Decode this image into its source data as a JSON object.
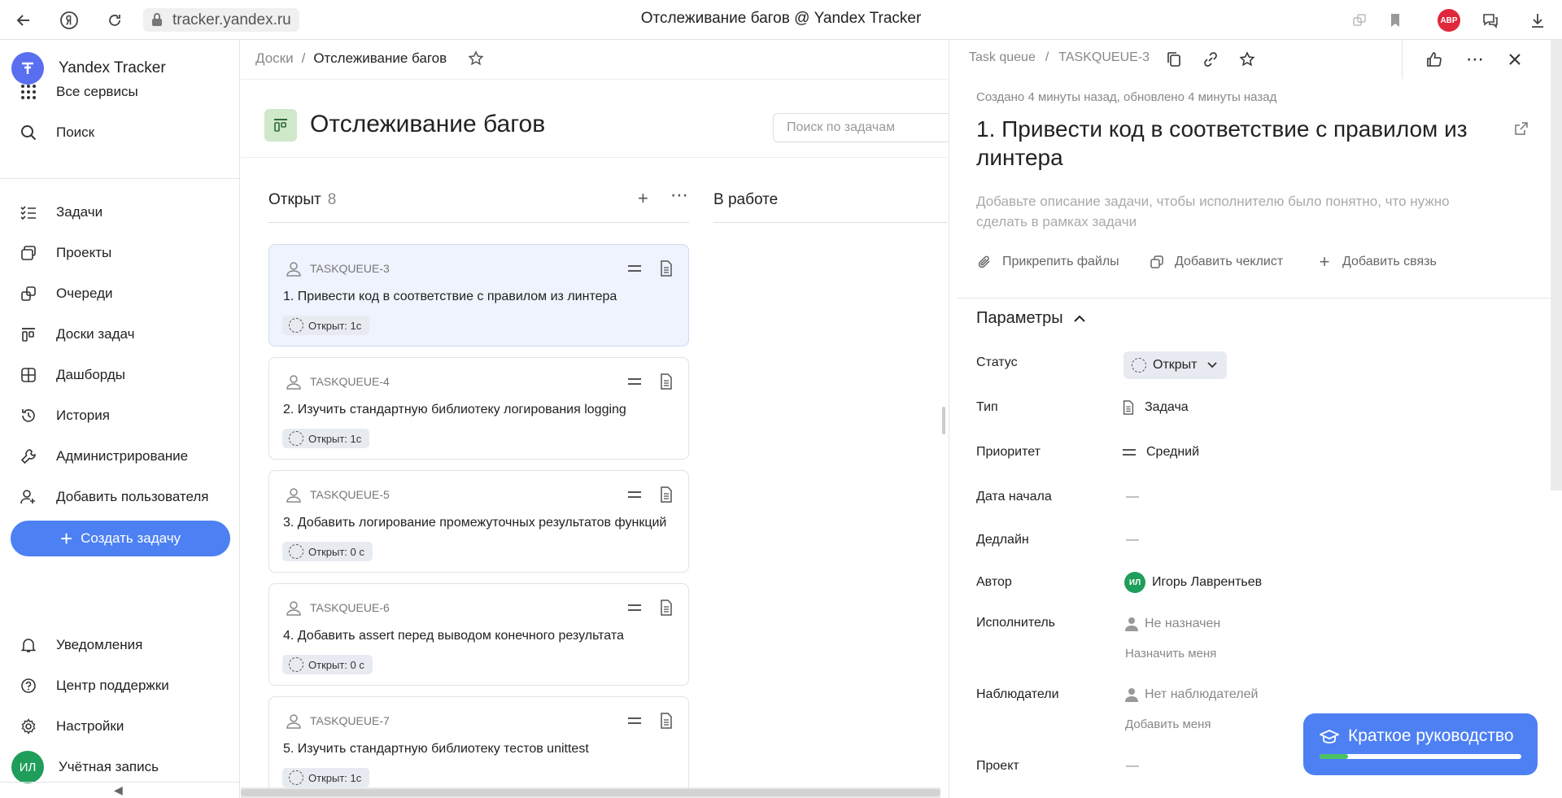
{
  "browser": {
    "url": "tracker.yandex.ru",
    "window_title": "Отслеживание багов @ Yandex Tracker",
    "abp_label": "ABP"
  },
  "sidebar": {
    "app_name": "Yandex Tracker",
    "all_services": "Все сервисы",
    "search": "Поиск",
    "items": [
      {
        "label": "Задачи",
        "icon": "tasks-icon"
      },
      {
        "label": "Проекты",
        "icon": "projects-icon"
      },
      {
        "label": "Очереди",
        "icon": "queues-icon"
      },
      {
        "label": "Доски задач",
        "icon": "boards-icon"
      },
      {
        "label": "Дашборды",
        "icon": "dashboards-icon"
      },
      {
        "label": "История",
        "icon": "history-icon"
      },
      {
        "label": "Администрирование",
        "icon": "admin-icon"
      },
      {
        "label": "Добавить пользователя",
        "icon": "add-user-icon"
      }
    ],
    "create_task": "Создать задачу",
    "bottom": {
      "notifications": "Уведомления",
      "support": "Центр поддержки",
      "settings": "Настройки",
      "account": "Учётная запись",
      "account_initials": "ИЛ"
    }
  },
  "board": {
    "breadcrumb_root": "Доски",
    "breadcrumb_current": "Отслеживание багов",
    "title": "Отслеживание багов",
    "search_placeholder": "Поиск по задачам",
    "columns": [
      {
        "name": "Открыт",
        "count": "8"
      },
      {
        "name": "В работе",
        "count": ""
      }
    ],
    "cards": [
      {
        "key": "TASKQUEUE-3",
        "title": "1. Привести код в соответствие с правилом из линтера",
        "status": "Открыт: 1с",
        "active": true
      },
      {
        "key": "TASKQUEUE-4",
        "title": "2. Изучить стандартную библиотеку логирования logging",
        "status": "Открыт: 1с",
        "active": false
      },
      {
        "key": "TASKQUEUE-5",
        "title": "3. Добавить логирование промежуточных результатов функций",
        "status": "Открыт: 0 с",
        "active": false
      },
      {
        "key": "TASKQUEUE-6",
        "title": "4. Добавить assert перед выводом конечного результата",
        "status": "Открыт: 0 с",
        "active": false
      },
      {
        "key": "TASKQUEUE-7",
        "title": "5. Изучить стандартную библиотеку тестов unittest",
        "status": "Открыт: 1с",
        "active": false
      }
    ]
  },
  "panel": {
    "breadcrumb_queue": "Task queue",
    "breadcrumb_key": "TASKQUEUE-3",
    "created": "Создано 4 минуты назад, обновлено 4 минуты назад",
    "title": "1. Привести код в соответствие с правилом из линтера",
    "description_placeholder": "Добавьте описание задачи, чтобы исполнителю было понятно, что нужно сделать в рамках задачи",
    "actions": {
      "attach": "Прикрепить файлы",
      "checklist": "Добавить чеклист",
      "link": "Добавить связь"
    },
    "params_title": "Параметры",
    "fields": {
      "status_label": "Статус",
      "status_value": "Открыт",
      "type_label": "Тип",
      "type_value": "Задача",
      "priority_label": "Приоритет",
      "priority_value": "Средний",
      "start_label": "Дата начала",
      "start_value": "—",
      "deadline_label": "Дедлайн",
      "deadline_value": "—",
      "author_label": "Автор",
      "author_initials": "ИЛ",
      "author_value": "Игорь Лаврентьев",
      "assignee_label": "Исполнитель",
      "assignee_value": "Не назначен",
      "assign_me": "Назначить меня",
      "watchers_label": "Наблюдатели",
      "watchers_value": "Нет наблюдателей",
      "add_me": "Добавить меня",
      "project_label": "Проект",
      "project_value": "—"
    }
  },
  "guide": {
    "label": "Краткое руководство",
    "progress": 0.14
  }
}
